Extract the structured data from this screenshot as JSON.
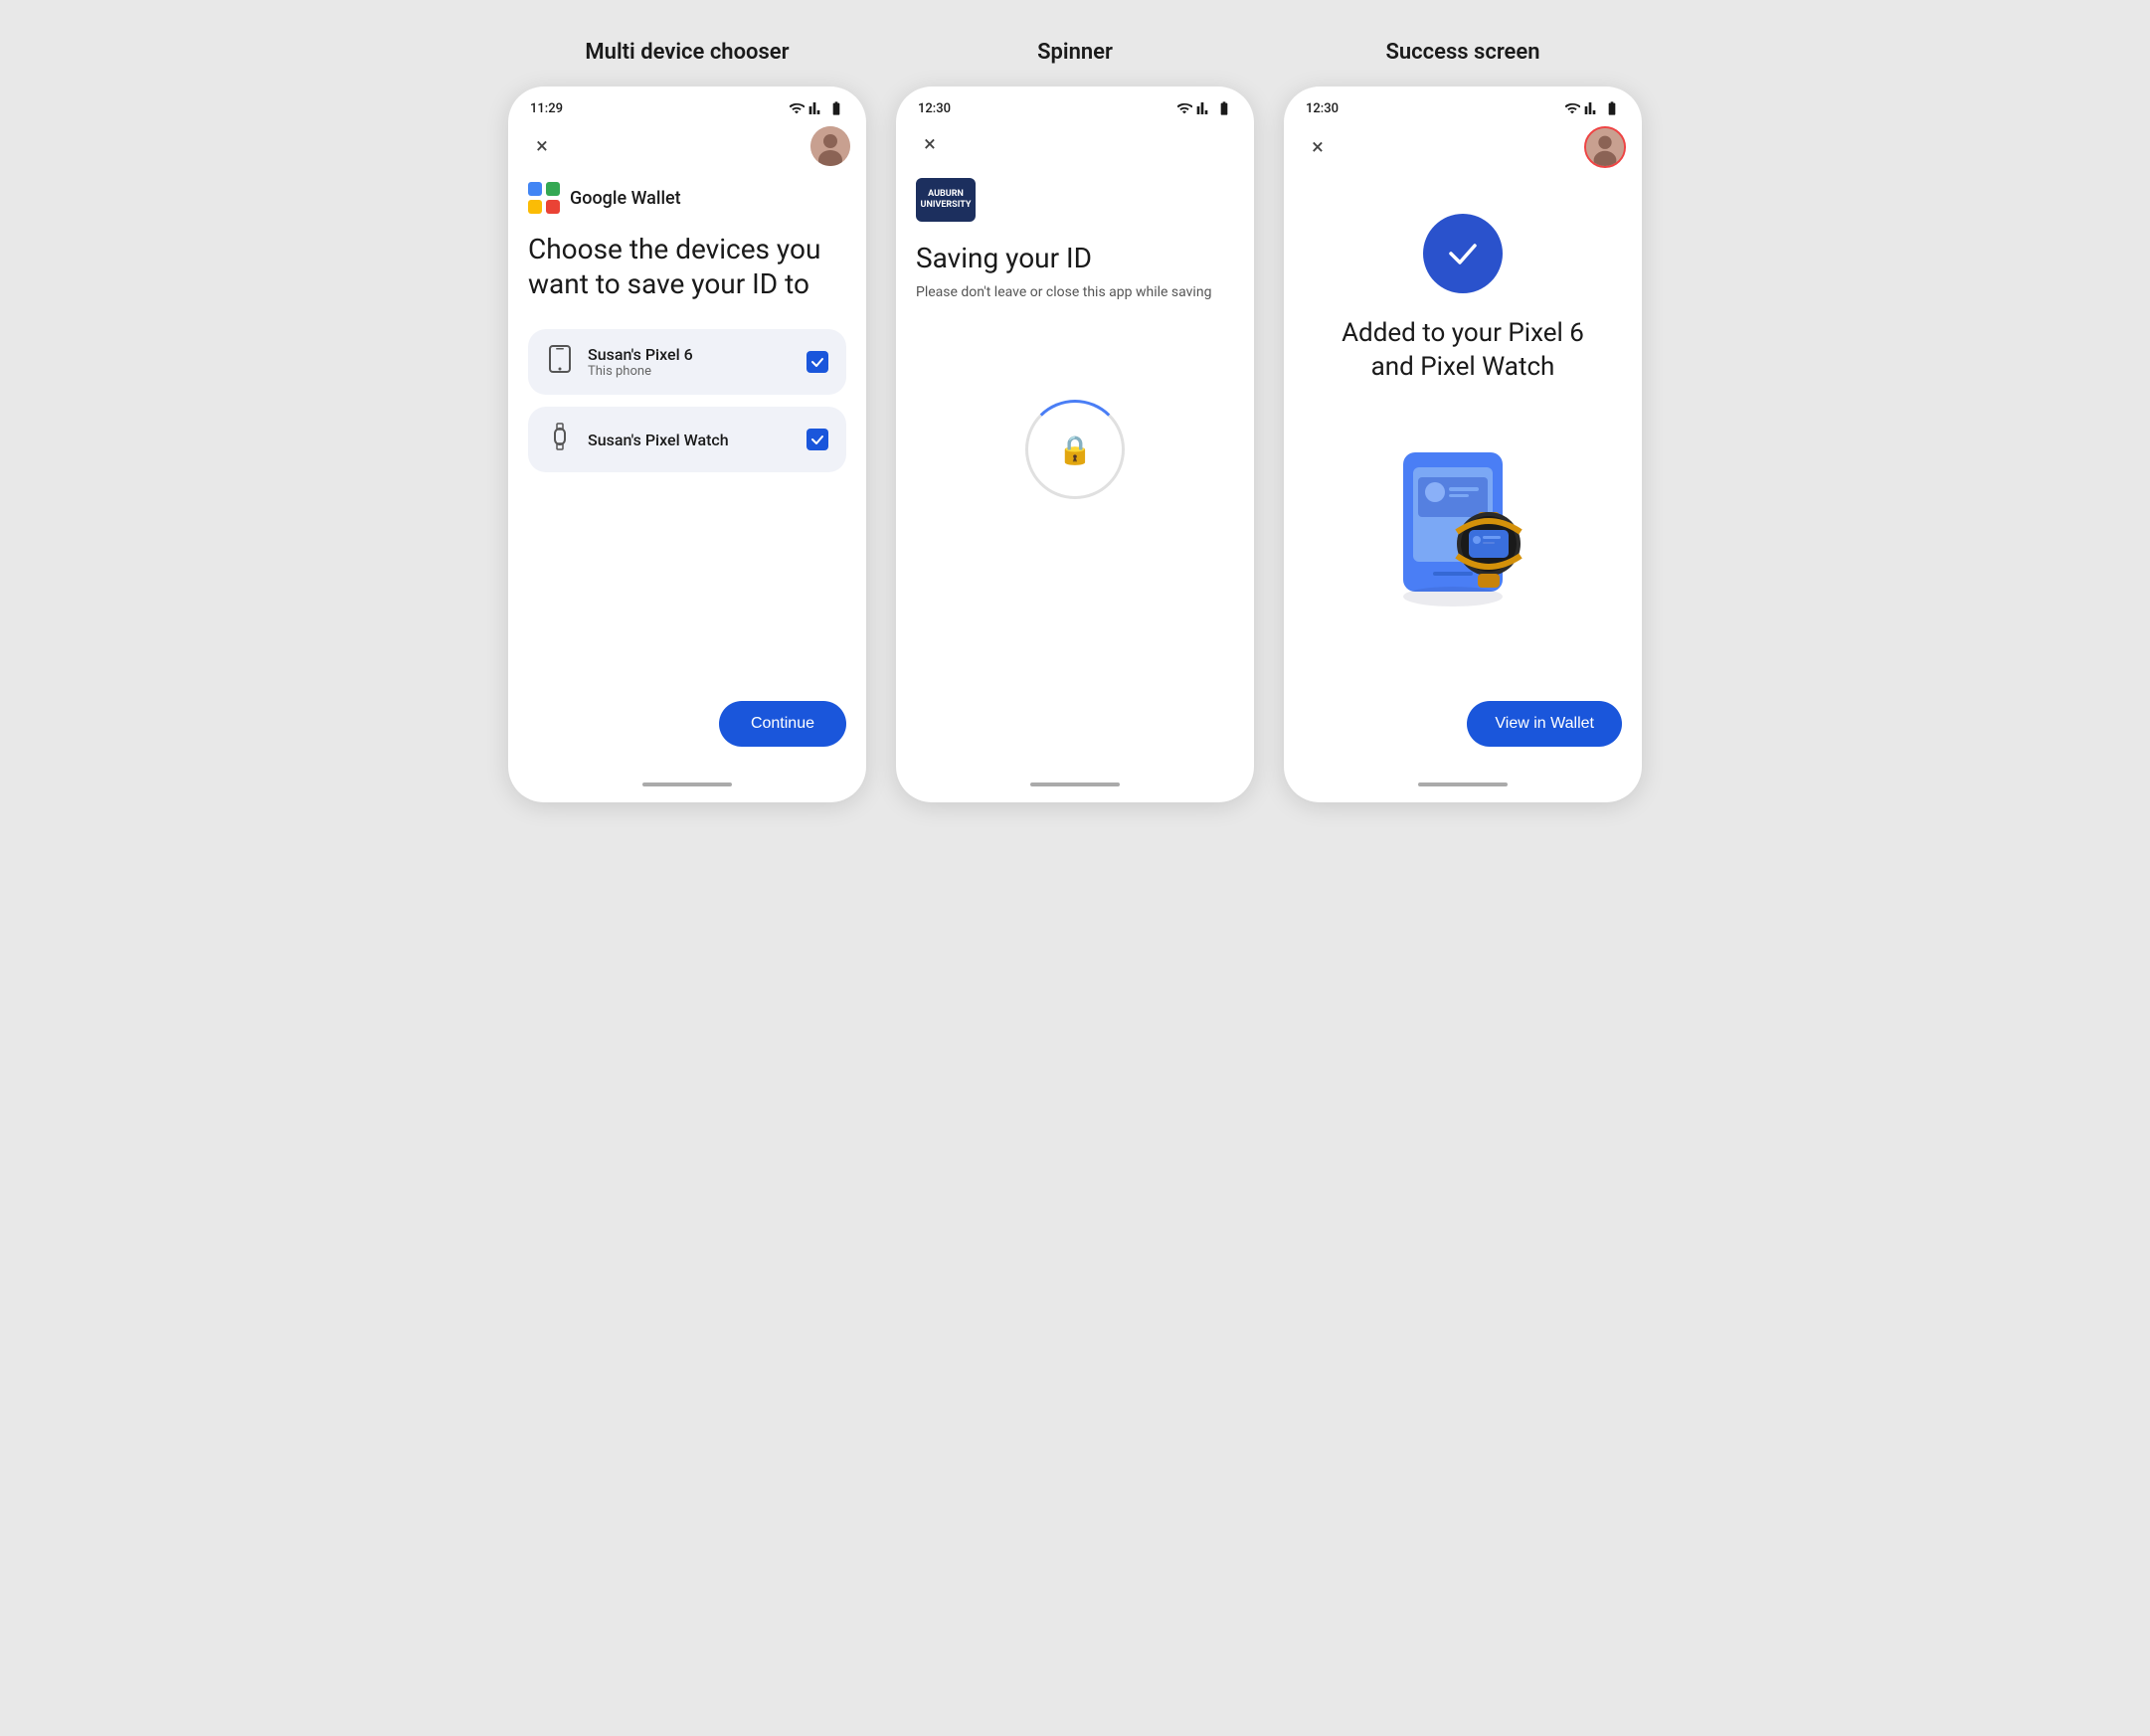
{
  "screens": [
    {
      "id": "multi-device-chooser",
      "title": "Multi device chooser",
      "statusTime": "11:29",
      "walletName": "Google Wallet",
      "chooseTitle": "Choose the devices you want to save your ID to",
      "devices": [
        {
          "name": "Susan's Pixel 6",
          "sub": "This phone",
          "icon": "phone",
          "checked": true
        },
        {
          "name": "Susan's Pixel Watch",
          "sub": "",
          "icon": "watch",
          "checked": true
        }
      ],
      "continueLabel": "Continue",
      "closeLabel": "×"
    },
    {
      "id": "spinner",
      "title": "Spinner",
      "statusTime": "12:30",
      "savingTitle": "Saving your ID",
      "savingSub": "Please don't leave or close this app while saving",
      "closeLabel": "×"
    },
    {
      "id": "success-screen",
      "title": "Success screen",
      "statusTime": "12:30",
      "successTitle": "Added to your Pixel 6 and Pixel Watch",
      "viewLabel": "View in Wallet",
      "closeLabel": "×"
    }
  ],
  "schoolLogoLine1": "AUBURN",
  "schoolLogoLine2": "UNIVERSITY"
}
